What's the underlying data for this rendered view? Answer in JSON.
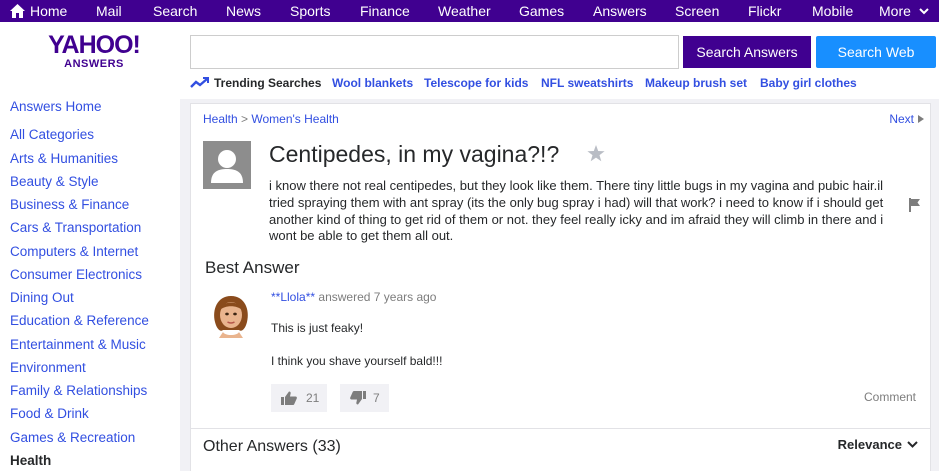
{
  "nav": {
    "items": [
      "Home",
      "Mail",
      "Search",
      "News",
      "Sports",
      "Finance",
      "Weather",
      "Games",
      "Answers",
      "Screen",
      "Flickr",
      "Mobile",
      "More"
    ],
    "icons": {
      "home": "home-icon",
      "more": "chevron-down-icon"
    }
  },
  "logo": {
    "main": "YAHOO!",
    "sub": "ANSWERS"
  },
  "search": {
    "value": "",
    "answers_button": "Search Answers",
    "web_button": "Search Web"
  },
  "trending": {
    "label": "Trending Searches",
    "icon": "trending-icon",
    "items": [
      "Wool blankets",
      "Telescope for kids",
      "NFL sweatshirts",
      "Makeup brush set",
      "Baby girl clothes"
    ]
  },
  "sidebar": {
    "items": [
      "Answers Home",
      "All Categories",
      "Arts & Humanities",
      "Beauty & Style",
      "Business & Finance",
      "Cars & Transportation",
      "Computers & Internet",
      "Consumer Electronics",
      "Dining Out",
      "Education & Reference",
      "Entertainment & Music",
      "Environment",
      "Family & Relationships",
      "Food & Drink",
      "Games & Recreation",
      "Health"
    ],
    "active": "Health"
  },
  "question": {
    "breadcrumb": [
      "Health",
      "Women's Health"
    ],
    "breadcrumb_separator": ">",
    "next_label": "Next",
    "title": "Centipedes, in my vagina?!?",
    "body": "i know there not real centipedes, but they look like them. There tiny little bugs in my vagina and pubic hair.il tried spraying them with ant spray (its the only bug spray i had) will that work? i need to know if i should get another kind of thing to get rid of them or not. they feel really icky and im afraid they will climb in there and i wont be able to get them all out."
  },
  "best_answer": {
    "heading": "Best Answer",
    "user": "**Llola**",
    "meta": "answered 7 years ago",
    "line1": "This is just feaky!",
    "line2": "I think you shave yourself bald!!!",
    "thumbs_up": "21",
    "thumbs_down": "7",
    "comment_label": "Comment"
  },
  "other_answers": {
    "label": "Other Answers (33)",
    "sort_label": "Relevance"
  },
  "colors": {
    "brand_purple": "#400090",
    "link_blue": "#324fe1",
    "web_blue": "#188fff",
    "muted_gray": "#7d7d7d"
  }
}
